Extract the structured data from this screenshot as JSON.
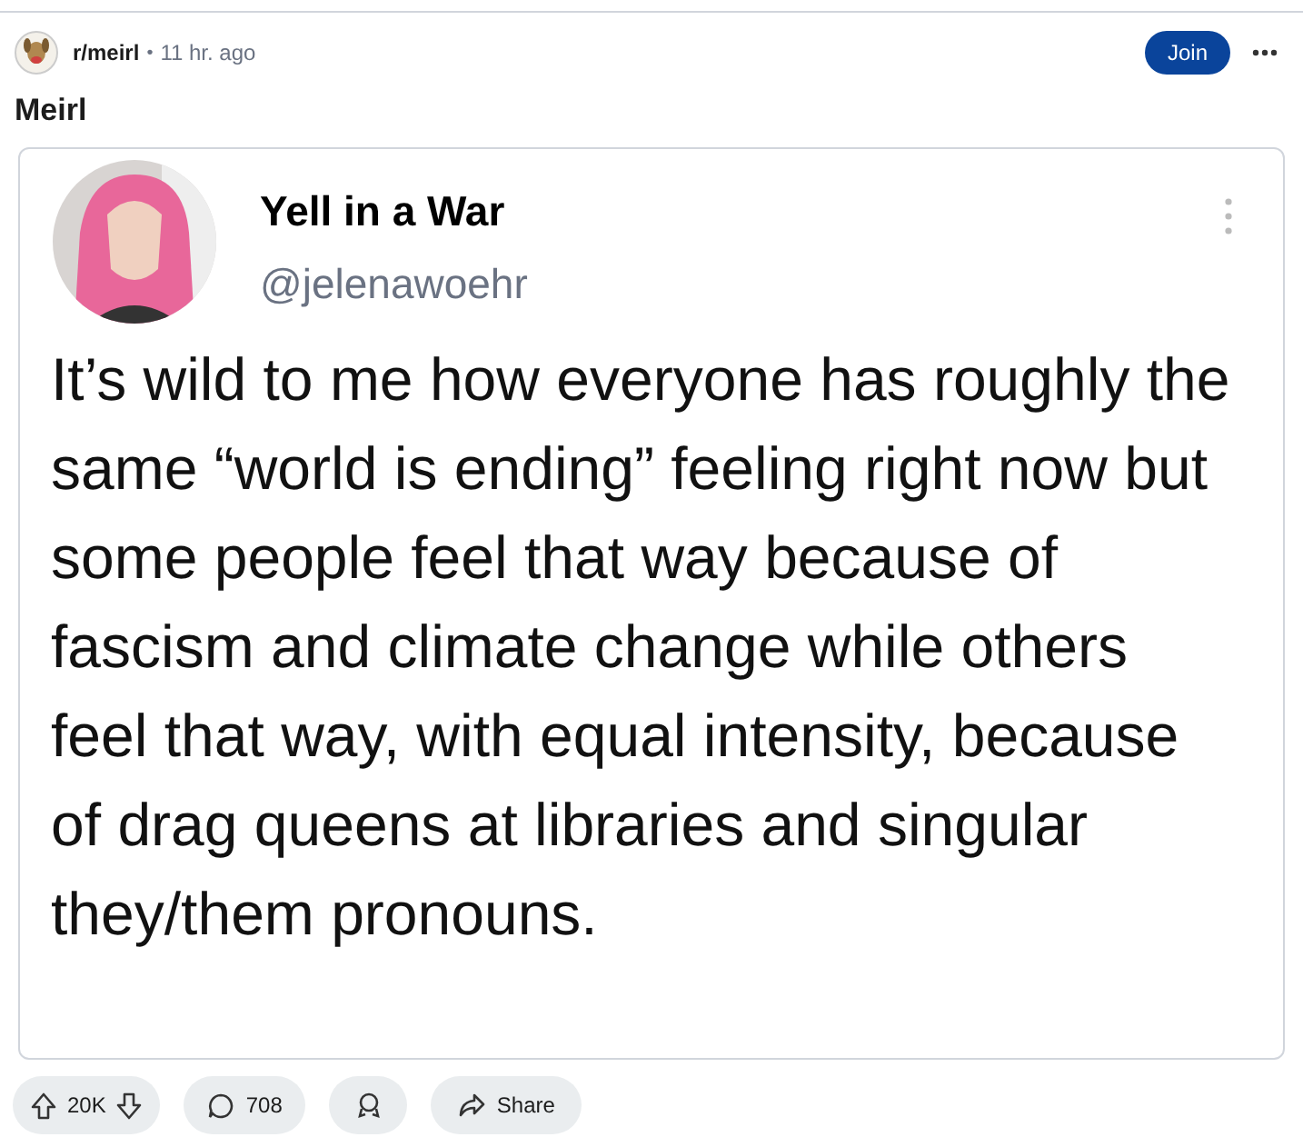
{
  "post": {
    "subreddit": "r/meirl",
    "separator": "•",
    "time": "11 hr. ago",
    "join_label": "Join",
    "title": "Meirl"
  },
  "tweet": {
    "display_name": "Yell in a War",
    "handle": "@jelenawoehr",
    "text": "It’s wild to me how everyone has roughly the same “world is ending” feeling right now but some people feel that way because of fascism and climate change while others feel that way, with equal intensity, because of drag queens at libraries and singular they/them pronouns."
  },
  "actions": {
    "votes": "20K",
    "comments": "708",
    "share_label": "Share"
  }
}
